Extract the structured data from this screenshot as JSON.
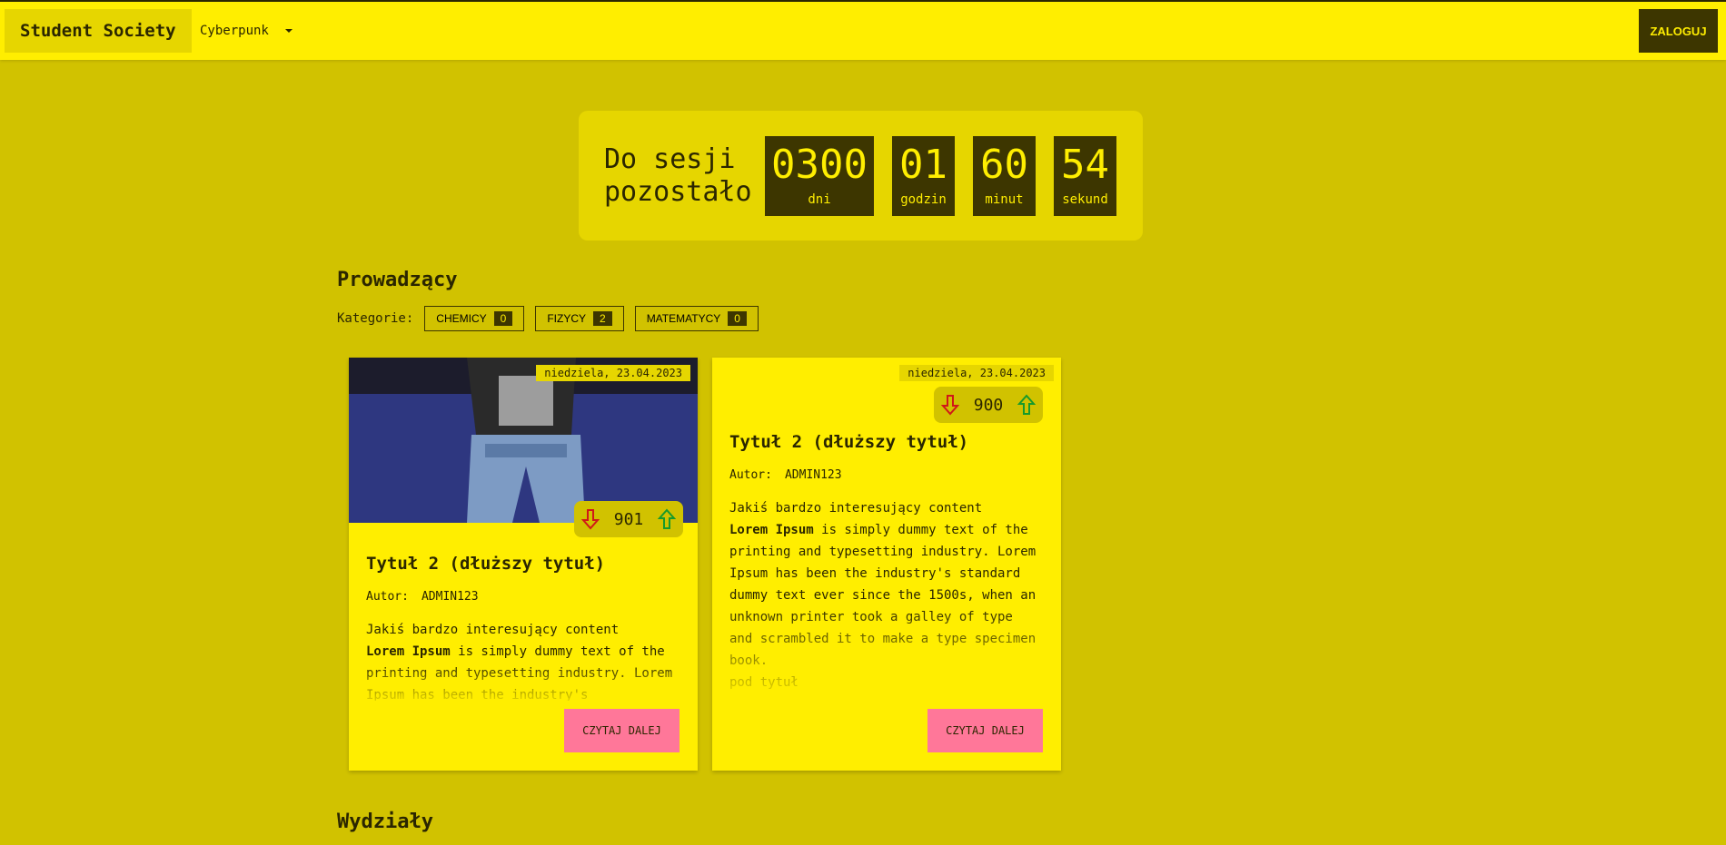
{
  "header": {
    "brand": "Student Society",
    "theme": "Cyberpunk",
    "login": "ZALOGUJ"
  },
  "countdown": {
    "label": "Do sesji\npozostało",
    "units": [
      {
        "value": "0300",
        "label": "dni"
      },
      {
        "value": "01",
        "label": "godzin"
      },
      {
        "value": "60",
        "label": "minut"
      },
      {
        "value": "54",
        "label": "sekund"
      }
    ]
  },
  "lecturers": {
    "title": "Prowadzący",
    "categories_label": "Kategorie:",
    "categories": [
      {
        "name": "CHEMICY",
        "count": "0"
      },
      {
        "name": "FIZYCY",
        "count": "2"
      },
      {
        "name": "MATEMATYCY",
        "count": "0"
      }
    ]
  },
  "cards": [
    {
      "date": "niedziela, 23.04.2023",
      "votes": "901",
      "title": "Tytuł 2 (dłuższy tytuł)",
      "author_label": "Autor:",
      "author": "ADMIN123",
      "body_intro": "Jakiś bardzo interesujący content",
      "body_bold": "Lorem Ipsum",
      "body_rest": " is simply dummy text of the printing and typesetting industry. Lorem Ipsum has been the industry's",
      "read_more": "CZYTAJ DALEJ"
    },
    {
      "date": "niedziela, 23.04.2023",
      "votes": "900",
      "title": "Tytuł 2 (dłuższy tytuł)",
      "author_label": "Autor:",
      "author": "ADMIN123",
      "body_intro": "Jakiś bardzo interesujący content",
      "body_bold": "Lorem Ipsum",
      "body_rest": " is simply dummy text of the printing and typesetting industry. Lorem Ipsum has been the industry's standard dummy text ever since the 1500s, when an unknown printer took a galley of type and scrambled it to make a type specimen book.",
      "body_sub": "pod tytuł",
      "read_more": "CZYTAJ DALEJ"
    }
  ],
  "faculties": {
    "title": "Wydziały"
  }
}
